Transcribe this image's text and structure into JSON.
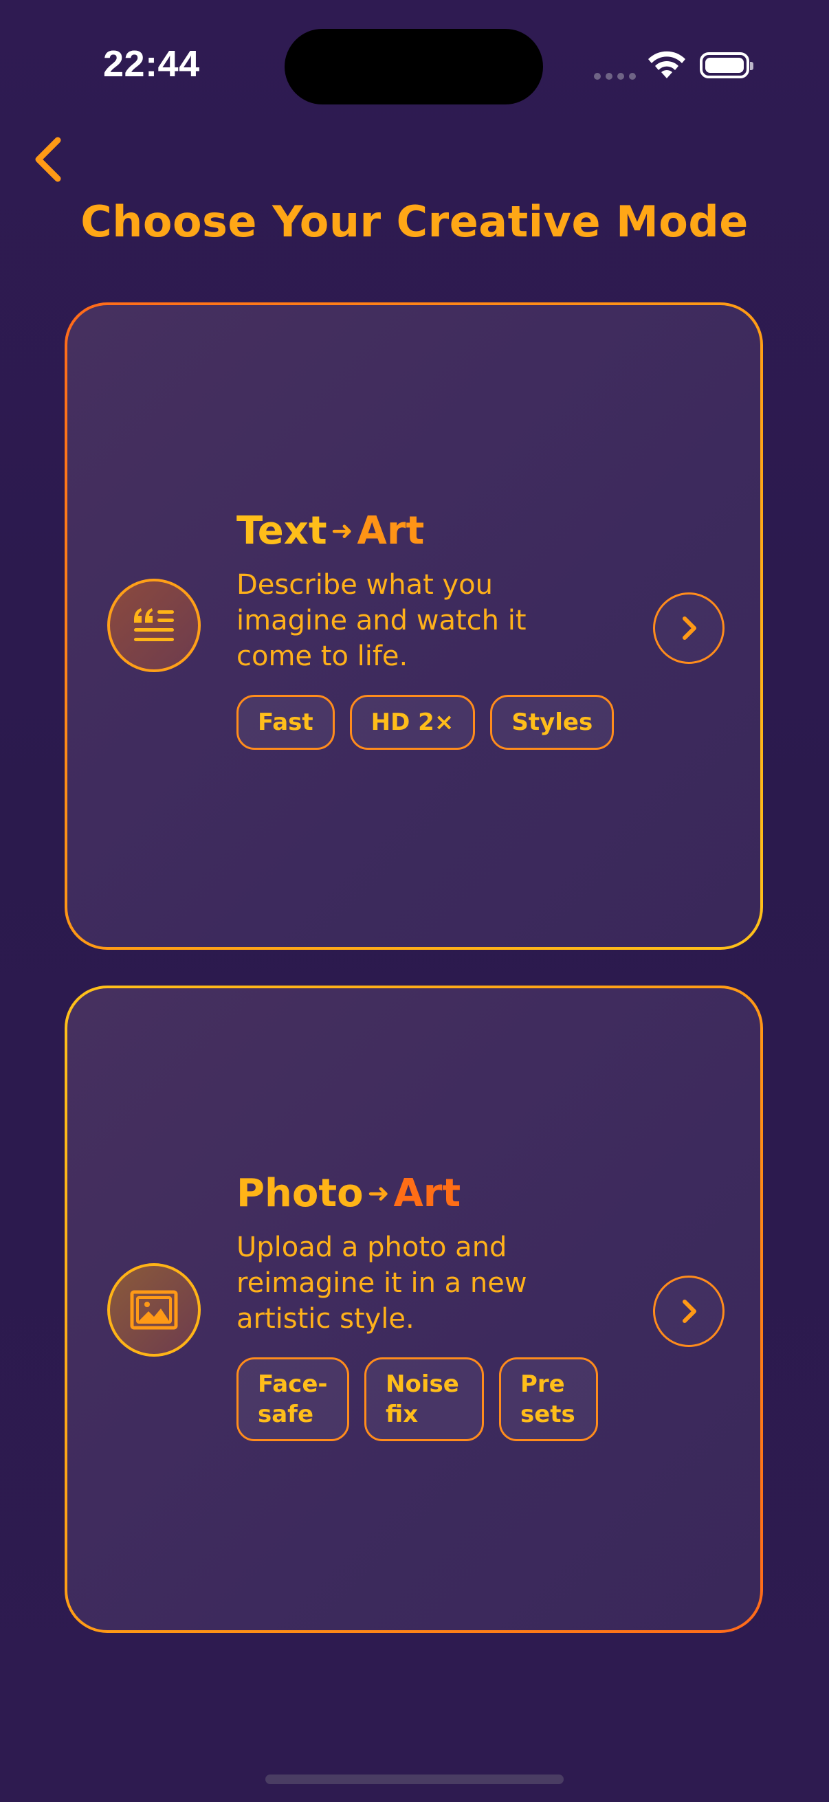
{
  "status_bar": {
    "time": "22:44"
  },
  "header": {
    "back_icon": "chevron-left-icon",
    "title": "Choose Your Creative Mode"
  },
  "colors": {
    "background": "#2e1b50",
    "accent_yellow": "#ffbe1a",
    "accent_orange": "#ff8c1c",
    "card_bg": "#3f2b5e"
  },
  "cards": [
    {
      "id": "text-to-art",
      "icon": "text-quote-icon",
      "title_part1": "Text",
      "arrow": "➜",
      "title_part2": "Art",
      "description": "Describe what you imagine and watch it come to life.",
      "tags": [
        "Fast",
        "HD 2×",
        "Styles"
      ],
      "go_icon": "chevron-right-icon"
    },
    {
      "id": "photo-to-art",
      "icon": "image-icon",
      "title_part1": "Photo",
      "arrow": "➜",
      "title_part2": "Art",
      "description": "Upload a photo and reimagine it in a new artistic style.",
      "tags": [
        "Face-safe",
        "Noise fix",
        "Presets"
      ],
      "go_icon": "chevron-right-icon"
    }
  ]
}
